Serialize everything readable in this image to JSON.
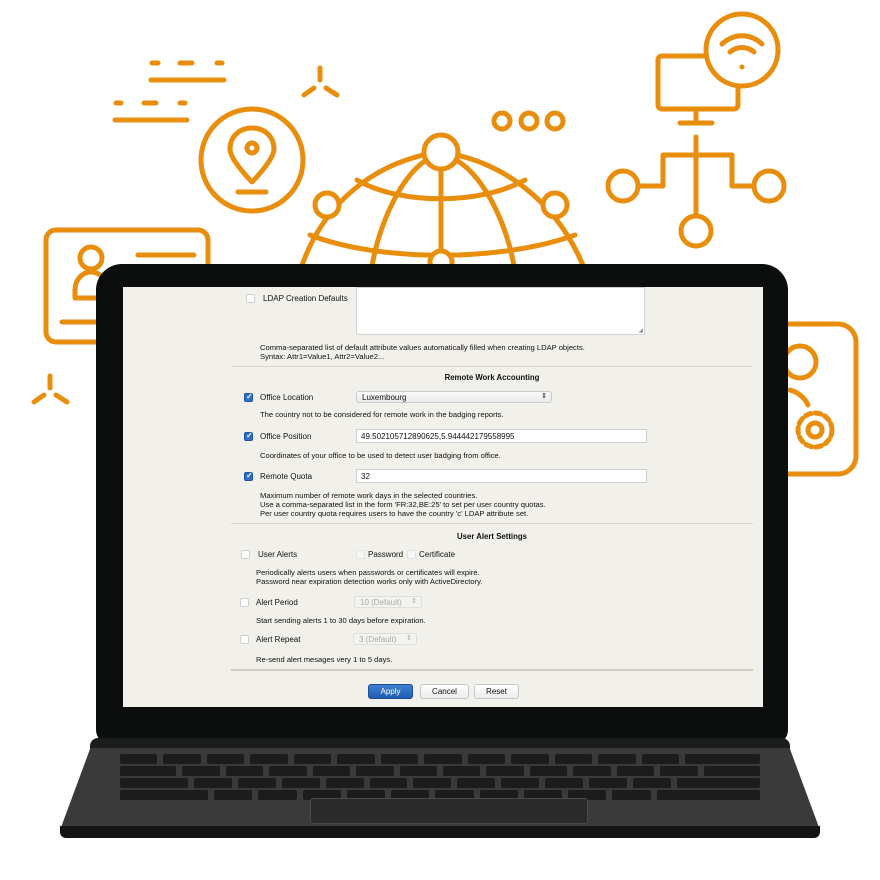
{
  "colors": {
    "accent": "#E88E0C",
    "primary_button": "#2563B8",
    "screen_bg": "#F1F0EA"
  },
  "decorations": [
    "dash-lines",
    "tri-spark-icon",
    "location-pin-icon",
    "globe-network-icon",
    "ellipsis-icon",
    "monitor-wifi-network-icon",
    "id-card-icon",
    "user-gear-card-icon"
  ],
  "form": {
    "ldap_defaults": {
      "label": "LDAP Creation Defaults",
      "checked": false,
      "value": "",
      "help": [
        "Comma-separated list of default attribute values automatically filled when creating LDAP objects.",
        "Syntax: Attr1=Value1, Attr2=Value2..."
      ]
    },
    "remote_work": {
      "title": "Remote Work Accounting",
      "office_location": {
        "label": "Office Location",
        "checked": true,
        "value": "Luxembourg",
        "help": "The country not to be considered for remote work in the badging reports."
      },
      "office_position": {
        "label": "Office Position",
        "checked": true,
        "value": "49.502105712890625,5.944442179558995",
        "help": "Coordinates of your office to be used to detect user badging from office."
      },
      "remote_quota": {
        "label": "Remote Quota",
        "checked": true,
        "value": "32",
        "help": [
          "Maximum number of remote work days in the selected countries.",
          "Use a comma-separated list in the form 'FR:32,BE:25' to set per user country quotas.",
          "Per user country quota requires users to have the country 'c' LDAP attribute set."
        ]
      }
    },
    "user_alerts": {
      "title": "User Alert Settings",
      "user_alerts": {
        "label": "User Alerts",
        "checked": false,
        "password_label": "Password",
        "certificate_label": "Certificate",
        "help": [
          "Periodically alerts users when passwords or certificates will expire.",
          "Password near expiration detection works only with ActiveDirectory."
        ]
      },
      "alert_period": {
        "label": "Alert Period",
        "checked": false,
        "value": "10 (Default)",
        "help": "Start sending alerts 1 to 30 days before expiration."
      },
      "alert_repeat": {
        "label": "Alert Repeat",
        "checked": false,
        "value": "3 (Default)",
        "help": "Re-send alert mesages very 1 to 5 days."
      }
    },
    "buttons": {
      "apply": "Apply",
      "cancel": "Cancel",
      "reset": "Reset"
    }
  }
}
